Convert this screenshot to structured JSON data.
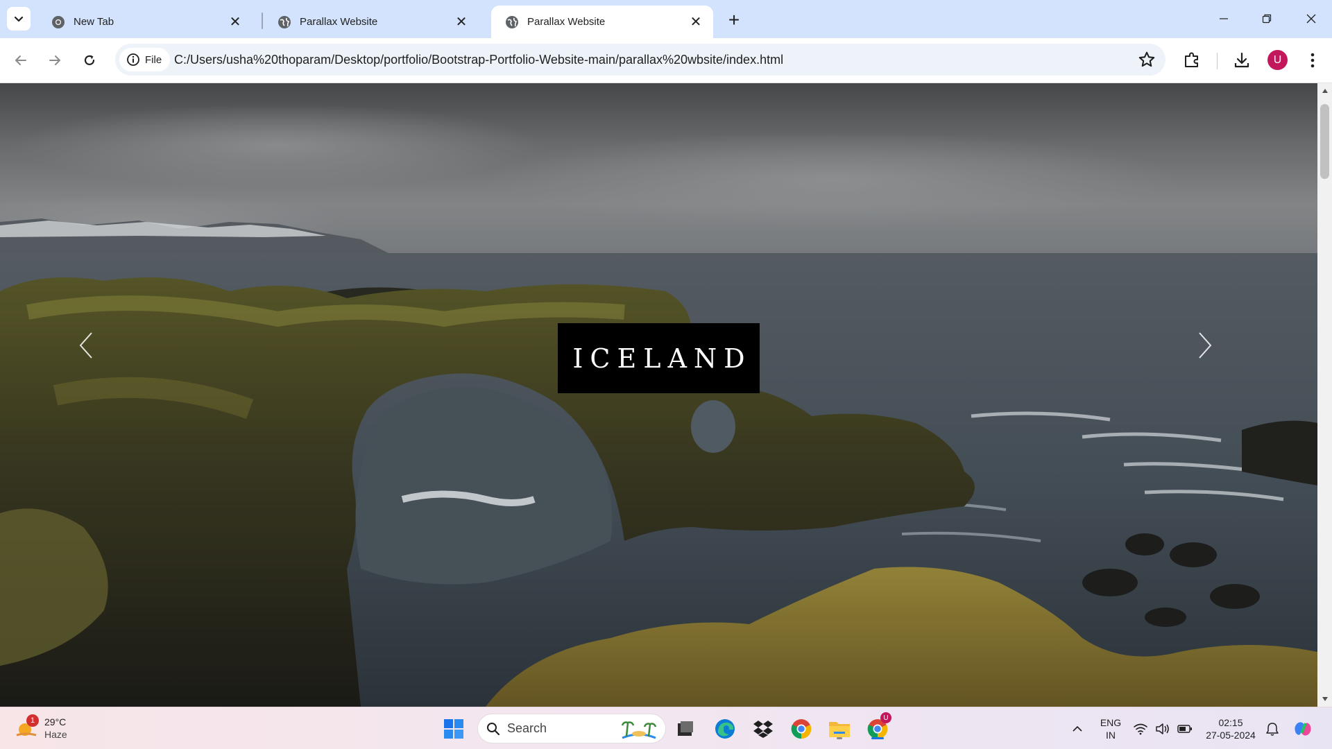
{
  "browser": {
    "tabs": [
      {
        "title": "New Tab",
        "active": false
      },
      {
        "title": "Parallax Website",
        "active": false
      },
      {
        "title": "Parallax Website",
        "active": true
      }
    ],
    "site_chip_label": "File",
    "url": "C:/Users/usha%20thoparam/Desktop/portfolio/Bootstrap-Portfolio-Website-main/parallax%20wbsite/index.html",
    "profile_initial": "U"
  },
  "page": {
    "caption": "ICELAND"
  },
  "taskbar": {
    "weather": {
      "temperature": "29°C",
      "condition": "Haze",
      "badge": "1"
    },
    "search_label": "Search",
    "chrome_badge": "U",
    "language": {
      "line1": "ENG",
      "line2": "IN"
    },
    "time": "02:15",
    "date": "27-05-2024"
  },
  "colors": {
    "tabstrip": "#d3e3fd",
    "caption_bg": "#000000",
    "avatar": "#c2185b"
  }
}
